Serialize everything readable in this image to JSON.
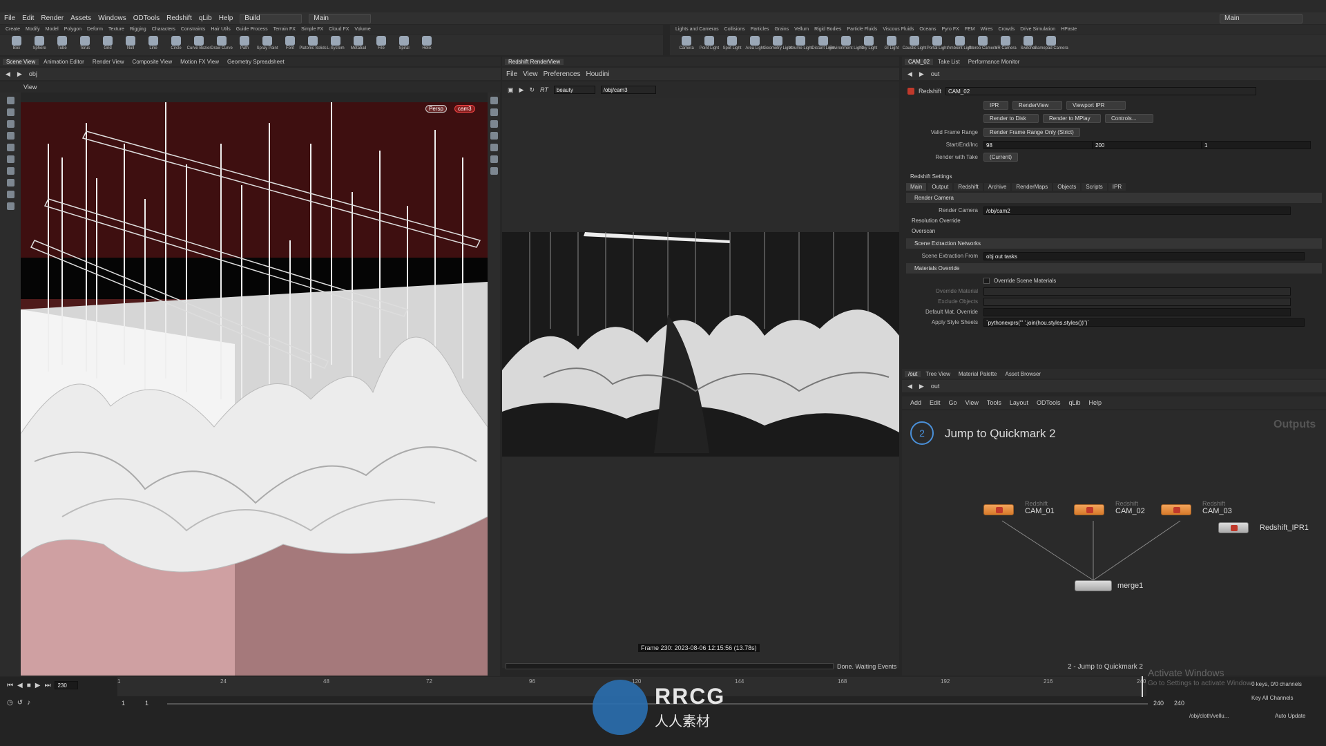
{
  "menu": {
    "items": [
      "File",
      "Edit",
      "Render",
      "Assets",
      "Windows",
      "ODTools",
      "Redshift",
      "qLib",
      "Help"
    ],
    "desktop": "Build",
    "main": "Main",
    "right_desktop": "Main"
  },
  "shelf_tabs_left": [
    "Create",
    "Modify",
    "Model",
    "Polygon",
    "Deform",
    "Texture",
    "Rigging",
    "Characters",
    "Constraints",
    "Hair Utils",
    "Guide Process",
    "Terrain FX",
    "Simple FX",
    "Cloud FX",
    "Volume"
  ],
  "shelf_tabs_right": [
    "Lights and Cameras",
    "Collisions",
    "Particles",
    "Grains",
    "Vellum",
    "Rigid Bodies",
    "Particle Fluids",
    "Viscous Fluids",
    "Oceans",
    "Pyro FX",
    "FEM",
    "Wires",
    "Crowds",
    "Drive Simulation",
    "HPaste"
  ],
  "tools_left": [
    "Box",
    "Sphere",
    "Tube",
    "Torus",
    "Grid",
    "Null",
    "Line",
    "Circle",
    "Curve Bezier",
    "Draw Curve",
    "Path",
    "Spray Paint",
    "Font",
    "Platonic Solids",
    "L-System",
    "Metaball",
    "File",
    "Spiral",
    "Helix"
  ],
  "tools_right": [
    "Camera",
    "Point Light",
    "Spot Light",
    "Area Light",
    "Geometry Light",
    "Volume Light",
    "Distant Light",
    "Environment Light",
    "Sky Light",
    "GI Light",
    "Caustic Light",
    "Portal Light",
    "Ambient Light",
    "Stereo Camera",
    "VR Camera",
    "Switcher",
    "Gamepad Camera"
  ],
  "left_pane": {
    "tabs": [
      "Scene View",
      "Animation Editor",
      "Render View",
      "Composite View",
      "Motion FX View",
      "Geometry Spreadsheet"
    ],
    "path": "obj",
    "view_label": "View",
    "persp": "Persp",
    "cam": "cam3"
  },
  "render_view": {
    "tab": "Redshift RenderView",
    "menu": [
      "File",
      "View",
      "Preferences",
      "Houdini"
    ],
    "rt": "RT",
    "aov": "beauty",
    "camera": "/obj/cam3",
    "frame_info": "Frame 230: 2023-08-06 12:15:56 (13.78s)",
    "status": "Done. Waiting Events"
  },
  "params": {
    "tabs": [
      "CAM_02",
      "Take List",
      "Performance Monitor"
    ],
    "path": "out",
    "node_type": "Redshift",
    "node_name": "CAM_02",
    "buttons_row1": [
      "IPR",
      "RenderView",
      "Viewport IPR"
    ],
    "buttons_row2": [
      "Render to Disk",
      "Render to MPlay",
      "Controls..."
    ],
    "valid_frame_range_label": "Valid Frame Range",
    "valid_frame_range": "Render Frame Range Only (Strict)",
    "start_end_label": "Start/End/Inc",
    "start": "98",
    "end": "200",
    "inc": "1",
    "take_label": "Render with Take",
    "take": "(Current)",
    "settings_label": "Redshift Settings",
    "settings_tabs": [
      "Main",
      "Output",
      "Redshift",
      "Archive",
      "RenderMaps",
      "Objects",
      "Scripts",
      "IPR"
    ],
    "render_camera_section": "Render Camera",
    "render_camera_label": "Render Camera",
    "render_camera": "/obj/cam2",
    "resolution_override": "Resolution Override",
    "overscan": "Overscan",
    "scene_extraction_section": "Scene Extraction Networks",
    "scene_extraction_label": "Scene Extraction From",
    "scene_extraction": "obj out tasks",
    "materials_section": "Materials Override",
    "override_scene_materials": "Override Scene Materials",
    "override_material": "Override Material",
    "exclude_objects": "Exclude Objects",
    "default_mat_override": "Default Mat. Override",
    "apply_style_label": "Apply Style Sheets",
    "apply_style": "`pythonexprs(\"' '.join(hou.styles.styles())\")`"
  },
  "network": {
    "tabs": [
      "/out",
      "Tree View",
      "Material Palette",
      "Asset Browser"
    ],
    "path": "out",
    "menu": [
      "Add",
      "Edit",
      "Go",
      "View",
      "Tools",
      "Layout",
      "ODTools",
      "qLib",
      "Help"
    ],
    "quickmark": "Jump to Quickmark 2",
    "quickmark_num": "2",
    "outputs": "Outputs",
    "footer": "2 - Jump to Quickmark 2",
    "nodes": [
      {
        "type": "Redshift",
        "name": "CAM_01"
      },
      {
        "type": "Redshift",
        "name": "CAM_02"
      },
      {
        "type": "Redshift",
        "name": "CAM_03"
      },
      {
        "type": "",
        "name": "Redshift_IPR1"
      },
      {
        "type": "",
        "name": "merge1"
      }
    ]
  },
  "timeline": {
    "frame": "230",
    "ticks": [
      "1",
      "24",
      "48",
      "72",
      "96",
      "120",
      "144",
      "168",
      "192",
      "216",
      "240"
    ],
    "start": "1",
    "start2": "1",
    "end": "240",
    "end2": "240",
    "keys": "0 keys, 0/0 channels",
    "key_all": "Key All Channels",
    "auto_update": "Auto Update",
    "status_path": "/obj/cloth/vellu..."
  },
  "watermark": {
    "line1": "RRCG",
    "line2": "人人素材"
  },
  "activate": {
    "line1": "Activate Windows",
    "line2": "Go to Settings to activate Windows."
  }
}
